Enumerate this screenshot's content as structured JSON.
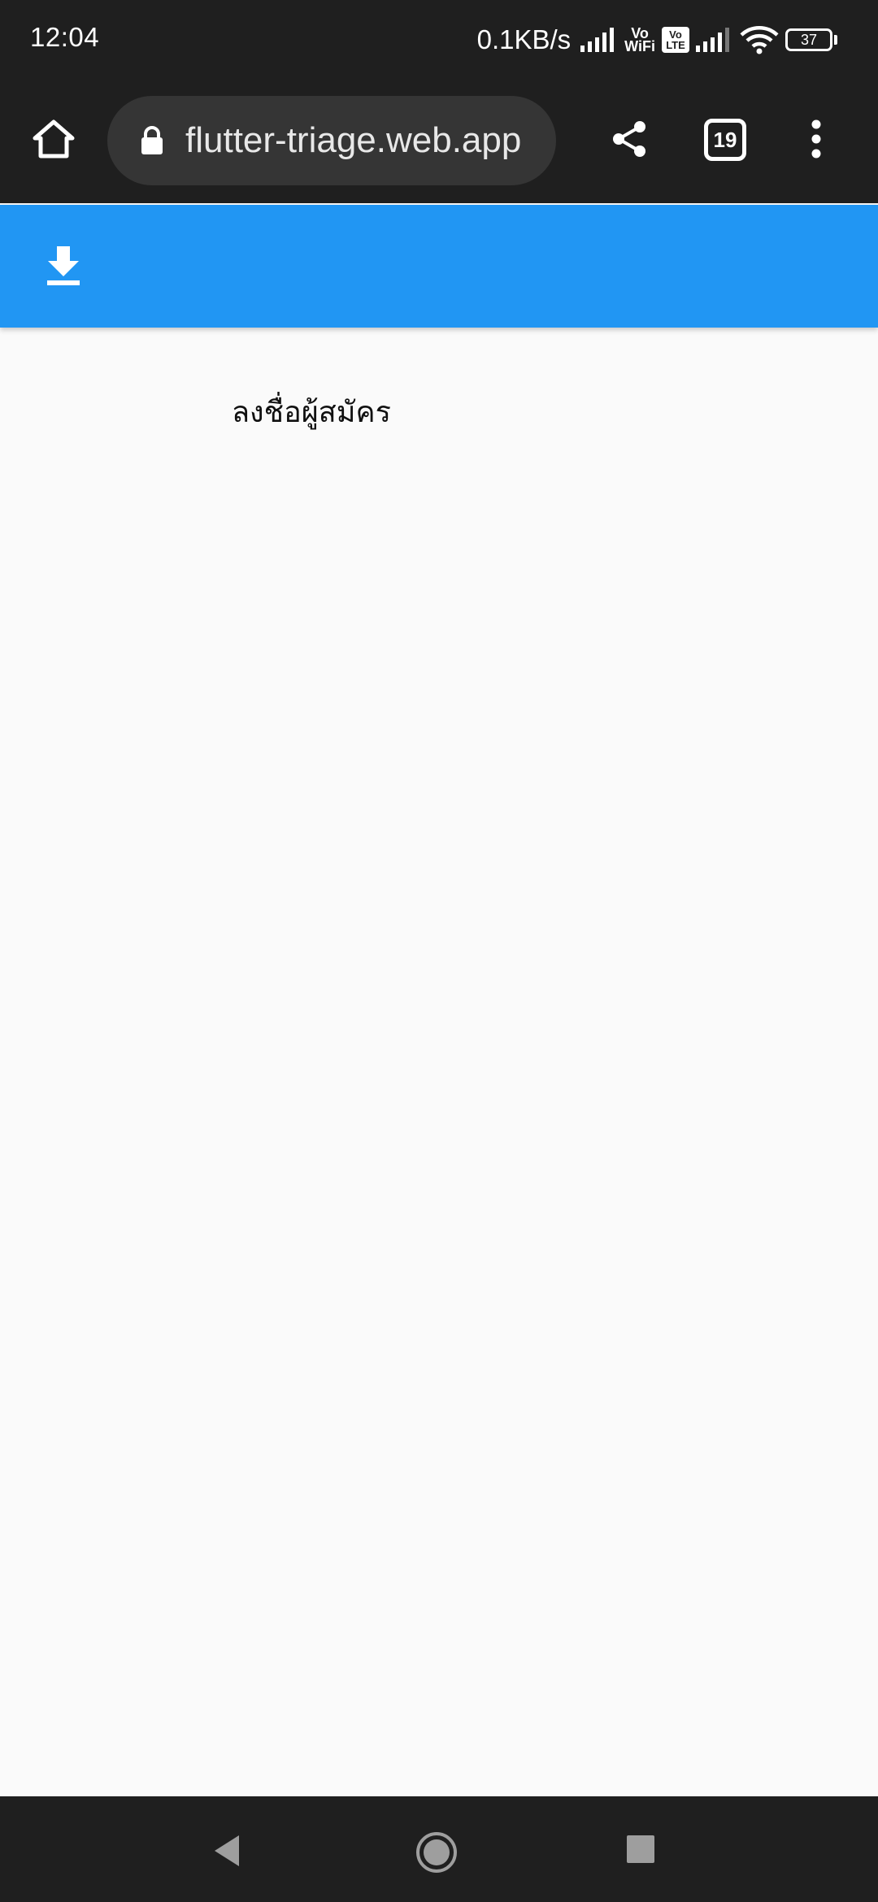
{
  "status_bar": {
    "time": "12:04",
    "net_speed": "0.1KB/s",
    "vowifi_label_top": "Vo",
    "vowifi_label_bottom": "WiFi",
    "volte_label_top": "Vo",
    "volte_label_bottom": "LTE",
    "battery_level": "37"
  },
  "browser": {
    "url": "flutter-triage.web.app",
    "tab_count": "19"
  },
  "content": {
    "label": "ลงชื่อผู้สมัคร"
  },
  "colors": {
    "app_bar": "#2196f3",
    "system_bars": "#1f1f1f",
    "url_box": "#353535",
    "page_background": "#fafafa"
  },
  "icons": {
    "home": "home-icon",
    "lock": "lock-icon",
    "share": "share-icon",
    "tabs": "tab-switcher-icon",
    "menu": "more-vert-icon",
    "download": "download-icon",
    "back": "back-icon",
    "nav_home": "nav-home-icon",
    "recents": "recents-icon"
  }
}
